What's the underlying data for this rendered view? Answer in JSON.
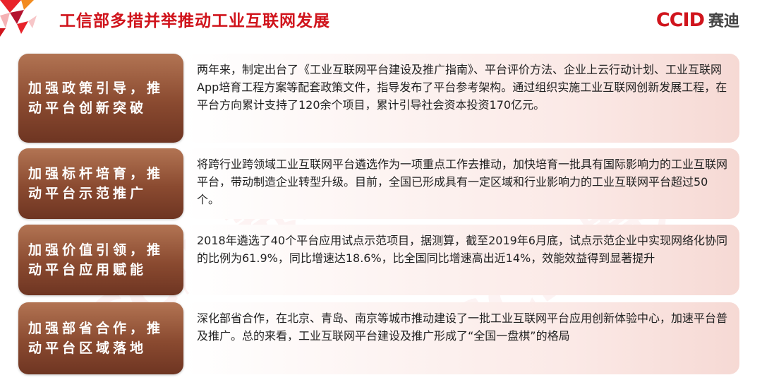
{
  "header": {
    "title": "工信部多措并举推动工业互联网发展",
    "logo_mark": "CCID",
    "logo_text": "赛迪",
    "watermark": "CCID赛迪"
  },
  "rows": [
    {
      "label": "加强政策引导，推动平台创新突破",
      "text": "两年来，制定出台了《工业互联网平台建设及推广指南》、平台评价方法、企业上云行动计划、工业互联网App培育工程方案等配套政策文件，指导发布了平台参考架构。通过组织实施工业互联网创新发展工程，在平台方向累计支持了120余个项目，累计引导社会资本投资170亿元。"
    },
    {
      "label": "加强标杆培育，推动平台示范推广",
      "text": "将跨行业跨领域工业互联网平台遴选作为一项重点工作去推动，加快培育一批具有国际影响力的工业互联网平台，带动制造企业转型升级。目前，全国已形成具有一定区域和行业影响力的工业互联网平台超过50个。"
    },
    {
      "label": "加强价值引领，推动平台应用赋能",
      "text": "2018年遴选了40个平台应用试点示范项目，据测算，截至2019年6月底，试点示范企业中实现网络化协同的比例为61.9%，同比增速达18.6%，比全国同比增速高出近14%，效能效益得到显著提升"
    },
    {
      "label": "加强部省合作，推动平台区域落地",
      "text": "深化部省合作，在北京、青岛、南京等城市推动建设了一批工业互联网平台应用创新体验中心，加速平台普及推广。总的来看，工业互联网平台建设及推广形成了“全国一盘棋”的格局"
    }
  ],
  "colors": {
    "title_red": "#d0141c",
    "label_brown": "#8a4a30"
  }
}
